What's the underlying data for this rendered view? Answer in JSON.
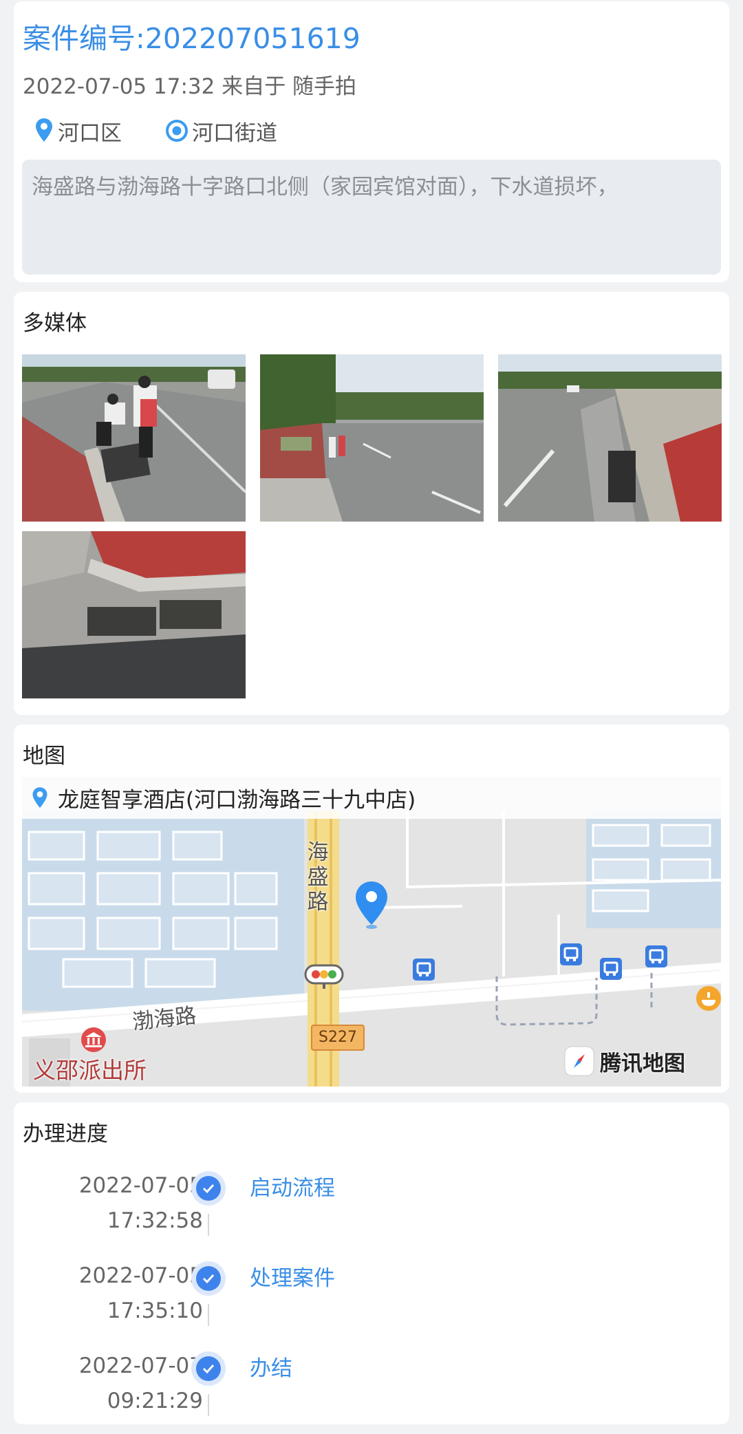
{
  "case": {
    "title": "案件编号:202207051619",
    "meta": "2022-07-05 17:32 来自于 随手拍",
    "district": "河口区",
    "street": "河口街道",
    "description": "海盛路与渤海路十字路口北侧（家园宾馆对面），下水道损坏，"
  },
  "media": {
    "section_title": "多媒体",
    "images": [
      {
        "name": "photo-1"
      },
      {
        "name": "photo-2"
      },
      {
        "name": "photo-3"
      },
      {
        "name": "photo-4"
      }
    ]
  },
  "map": {
    "section_title": "地图",
    "place_name": "龙庭智享酒店(河口渤海路三十九中店)",
    "road_vertical": "海盛路",
    "road_horizontal": "渤海路",
    "poi_police": "义邵派出所",
    "route_badge": "S227",
    "provider": "腾讯地图"
  },
  "progress": {
    "section_title": "办理进度",
    "steps": [
      {
        "date": "2022-07-05",
        "time": "17:32:58",
        "label": "启动流程"
      },
      {
        "date": "2022-07-05",
        "time": "17:35:10",
        "label": "处理案件"
      },
      {
        "date": "2022-07-07",
        "time": "09:21:29",
        "label": "办结"
      }
    ]
  },
  "colors": {
    "accent": "#3a8ee6",
    "page_bg": "#f1f2f4",
    "step_dot": "#3e83ec"
  }
}
